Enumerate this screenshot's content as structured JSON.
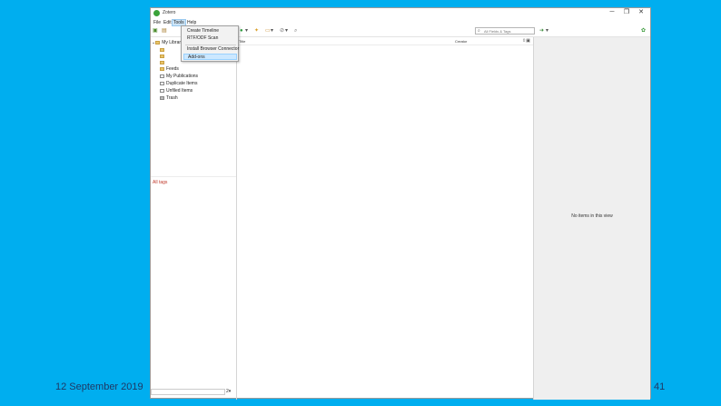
{
  "window": {
    "title": "Zotero",
    "controls": {
      "minimize": "─",
      "maximize": "❐",
      "close": "✕"
    }
  },
  "menubar": [
    "File",
    "Edit",
    "Tools",
    "Help"
  ],
  "tools_menu": {
    "items": [
      "Create Timeline",
      "RTF/ODF Scan",
      "Install Browser Connector",
      "Add-ons"
    ],
    "highlighted": "Add-ons"
  },
  "toolbar": {
    "search_placeholder": "All Fields & Tags"
  },
  "library_tree": {
    "root": "My Library",
    "items": [
      "Feeds",
      "My Publications",
      "Duplicate Items",
      "Unfiled Items",
      "Trash"
    ]
  },
  "tag_selector": {
    "label": "All tags",
    "button": "2▾"
  },
  "items_pane": {
    "columns": {
      "title": "Title",
      "creator": "Creator"
    }
  },
  "item_pane": {
    "message": "No items in this view"
  },
  "slide_footer": {
    "date": "12 September 2019",
    "page": "41"
  },
  "colors": {
    "background": "#00aeef",
    "menu_highlight": "#cce8ff",
    "tag_label": "#c0392b"
  }
}
